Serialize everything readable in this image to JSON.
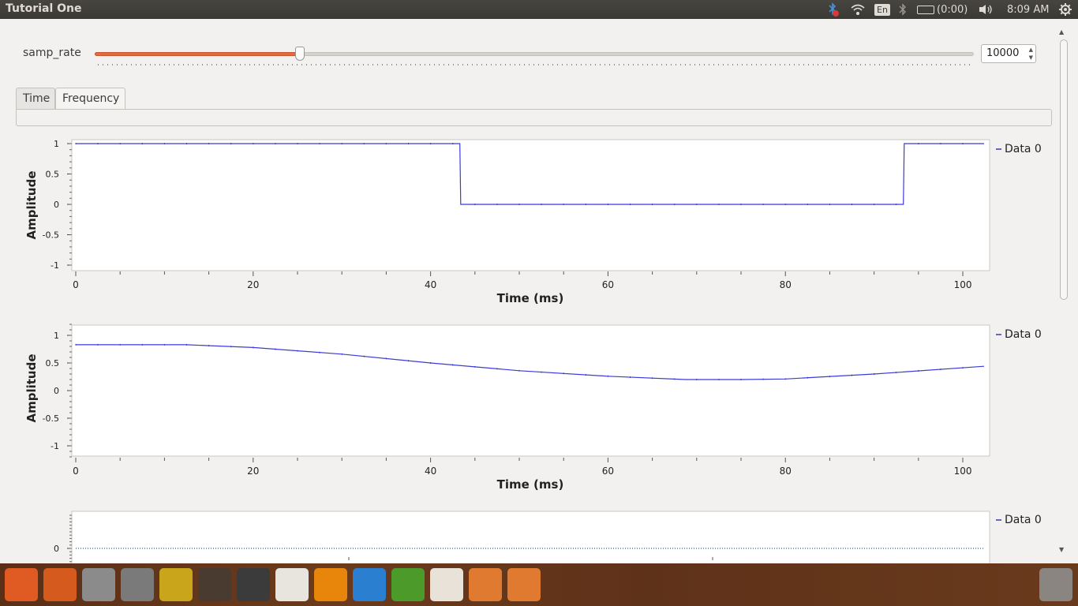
{
  "window": {
    "title": "Tutorial One"
  },
  "panel": {
    "battery_text": "(0:00)",
    "clock": "8:09 AM",
    "keyboard_layout": "En"
  },
  "controls": {
    "slider_label": "samp_rate",
    "slider_value": 10000,
    "slider_fraction": 0.233
  },
  "tabs": [
    {
      "label": "Time",
      "active": false
    },
    {
      "label": "Frequency",
      "active": true
    }
  ],
  "plots": {
    "square": {
      "ylabel": "Amplitude",
      "xlabel": "Time (ms)",
      "legend": "Data 0"
    },
    "sine": {
      "ylabel": "Amplitude",
      "xlabel": "Time (ms)",
      "legend": "Data 0"
    },
    "third": {
      "legend": "Data 0"
    }
  },
  "chart_data": [
    {
      "type": "line",
      "series": [
        {
          "name": "Data 0",
          "x": [
            0,
            43.3,
            43.4,
            93.3,
            93.4,
            102.4
          ],
          "y": [
            1,
            1,
            0,
            0,
            1,
            1
          ]
        }
      ],
      "xlabel": "Time (ms)",
      "ylabel": "Amplitude",
      "xlim": [
        0,
        102.4
      ],
      "ylim": [
        -1,
        1
      ],
      "xticks": [
        "0",
        "20",
        "40",
        "60",
        "80",
        "100"
      ],
      "yticks": [
        "1",
        "0.5",
        "0",
        "-0.5",
        "-1"
      ],
      "legend_position": "right"
    },
    {
      "type": "line",
      "series": [
        {
          "name": "Data 0",
          "x": [
            0,
            12.5,
            20,
            30,
            40,
            50,
            60,
            68.75,
            75,
            80,
            90,
            102.4
          ],
          "y": [
            0.83,
            0.83,
            0.78,
            0.66,
            0.5,
            0.36,
            0.26,
            0.2,
            0.2,
            0.21,
            0.3,
            0.44
          ]
        }
      ],
      "xlabel": "Time (ms)",
      "ylabel": "Amplitude",
      "xlim": [
        0,
        102.4
      ],
      "ylim": [
        -1.2,
        1.2
      ],
      "xticks": [
        "0",
        "20",
        "40",
        "60",
        "80",
        "100"
      ],
      "yticks": [
        "1",
        "0.5",
        "0",
        "-0.5",
        "-1"
      ],
      "legend_position": "right"
    },
    {
      "type": "line",
      "series": [
        {
          "name": "Data 0",
          "x": [
            0,
            102.4
          ],
          "y": [
            0,
            0
          ]
        }
      ],
      "yticks": [
        "0"
      ],
      "legend_position": "right"
    }
  ],
  "launcher": [
    {
      "name": "dash-home-icon",
      "color": "#e05a24"
    },
    {
      "name": "software-center-icon",
      "color": "#d45a1e"
    },
    {
      "name": "file-manager-icon",
      "color": "#8b8b8b"
    },
    {
      "name": "system-settings-icon",
      "color": "#7a7a7a"
    },
    {
      "name": "text-editor-icon",
      "color": "#c9a51c"
    },
    {
      "name": "workspace-switcher-icon",
      "color": "#4a3b30"
    },
    {
      "name": "terminal-icon",
      "color": "#3b3b3b"
    },
    {
      "name": "document-viewer-icon",
      "color": "#e8e4de"
    },
    {
      "name": "vlc-icon",
      "color": "#e8860c"
    },
    {
      "name": "media-player-icon",
      "color": "#2a7fd1"
    },
    {
      "name": "android-sdk-icon",
      "color": "#4c9a2a"
    },
    {
      "name": "chrome-icon",
      "color": "#e8e2d8"
    },
    {
      "name": "gnuradio-companion-icon",
      "color": "#e07a30"
    },
    {
      "name": "gnuradio-flowgraph-icon",
      "color": "#e07a30"
    }
  ]
}
